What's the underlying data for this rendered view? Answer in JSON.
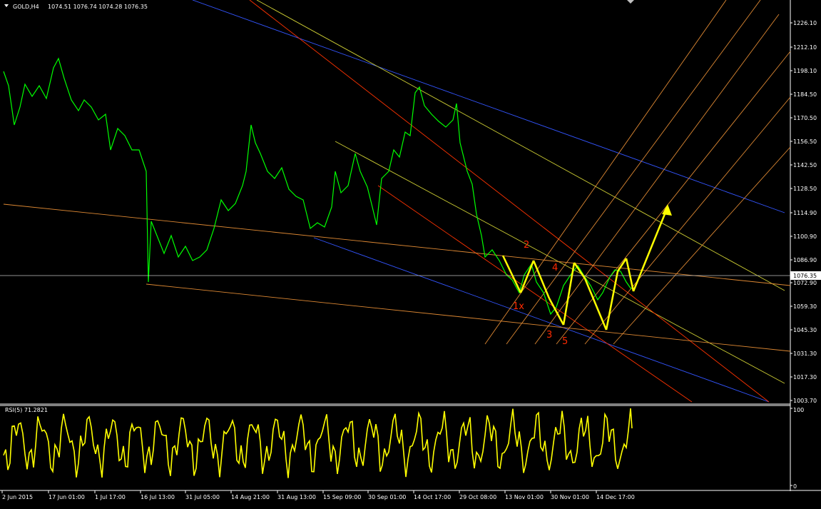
{
  "header": {
    "symbol_label": "GOLD,H4",
    "ohlc": "1074.51 1076.74 1074.28 1076.35"
  },
  "price_axis": {
    "ticks": [
      "1226.10",
      "1212.10",
      "1198.10",
      "1184.50",
      "1170.50",
      "1156.50",
      "1142.50",
      "1128.50",
      "1114.90",
      "1100.90",
      "1086.90",
      "1072.90",
      "1059.30",
      "1045.30",
      "1031.30",
      "1017.30",
      "1003.70"
    ],
    "current_price": "1076.35"
  },
  "rsi": {
    "label": "RSI(5) 71.2821",
    "axis_top": "100",
    "axis_bottom": "0"
  },
  "time_axis": {
    "ticks": [
      "2 Jun 2015",
      "17 Jun 01:00",
      "1 Jul 17:00",
      "16 Jul 13:00",
      "31 Jul 05:00",
      "14 Aug 21:00",
      "31 Aug 13:00",
      "15 Sep 09:00",
      "30 Sep 01:00",
      "14 Oct 17:00",
      "29 Oct 08:00",
      "13 Nov 01:00",
      "30 Nov 01:00",
      "14 Dec 17:00"
    ]
  },
  "wave_labels": [
    "1x",
    "2",
    "3",
    "4",
    "5"
  ],
  "colors": {
    "background": "#000000",
    "price_line": "#00ff00",
    "rsi_line": "#ffff00",
    "wave_arrows": "#ffff00",
    "wave_labels": "#ff2a00",
    "axis_text": "#ffffff",
    "current_price_line": "#c0c0c0"
  },
  "chart_data": [
    {
      "type": "line",
      "series": [
        {
          "name": "GOLD,H4",
          "x": [
            "2 Jun 2015",
            "17 Jun 01:00",
            "1 Jul 17:00",
            "16 Jul 13:00",
            "31 Jul 05:00",
            "14 Aug 21:00",
            "31 Aug 13:00",
            "15 Sep 09:00",
            "30 Sep 01:00",
            "14 Oct 17:00",
            "29 Oct 08:00",
            "13 Nov 01:00",
            "30 Nov 01:00",
            "14 Dec 17:00"
          ],
          "values": [
            1192,
            1180,
            1170,
            1086,
            1090,
            1118,
            1132,
            1110,
            1128,
            1180,
            1140,
            1090,
            1060,
            1075
          ]
        }
      ],
      "ylim": [
        1003.7,
        1232
      ]
    },
    {
      "type": "line",
      "series": [
        {
          "name": "RSI(5)",
          "values": [
            71.2821
          ]
        }
      ],
      "ylim": [
        0,
        100
      ]
    }
  ]
}
